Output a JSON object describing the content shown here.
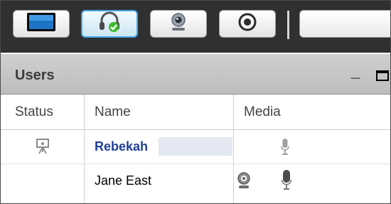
{
  "toolbar": {
    "buttons": [
      {
        "icon": "monitor-icon",
        "active": false
      },
      {
        "icon": "headset-check-icon",
        "active": true
      },
      {
        "icon": "webcam-icon",
        "active": false
      },
      {
        "icon": "record-icon",
        "active": false
      }
    ]
  },
  "users_panel": {
    "title": "Users",
    "minimize_glyph": "_",
    "columns": [
      "Status",
      "Name",
      "Media"
    ]
  },
  "users": [
    {
      "name": "Rebekah",
      "bold": true,
      "name_color": "#1f3f9a",
      "status_icon": "presenter-icon",
      "media": [
        "microphone-icon"
      ]
    },
    {
      "name": "Jane East",
      "bold": false,
      "name_color": "#000000",
      "status_icon": "",
      "media": [
        "webcam-icon",
        "microphone-icon"
      ]
    }
  ],
  "colors": {
    "toolbar_bg": "#2f3032",
    "accent": "#4aa6e8",
    "header_bg": "#c6c6c6",
    "check_green": "#3dbb2a"
  }
}
